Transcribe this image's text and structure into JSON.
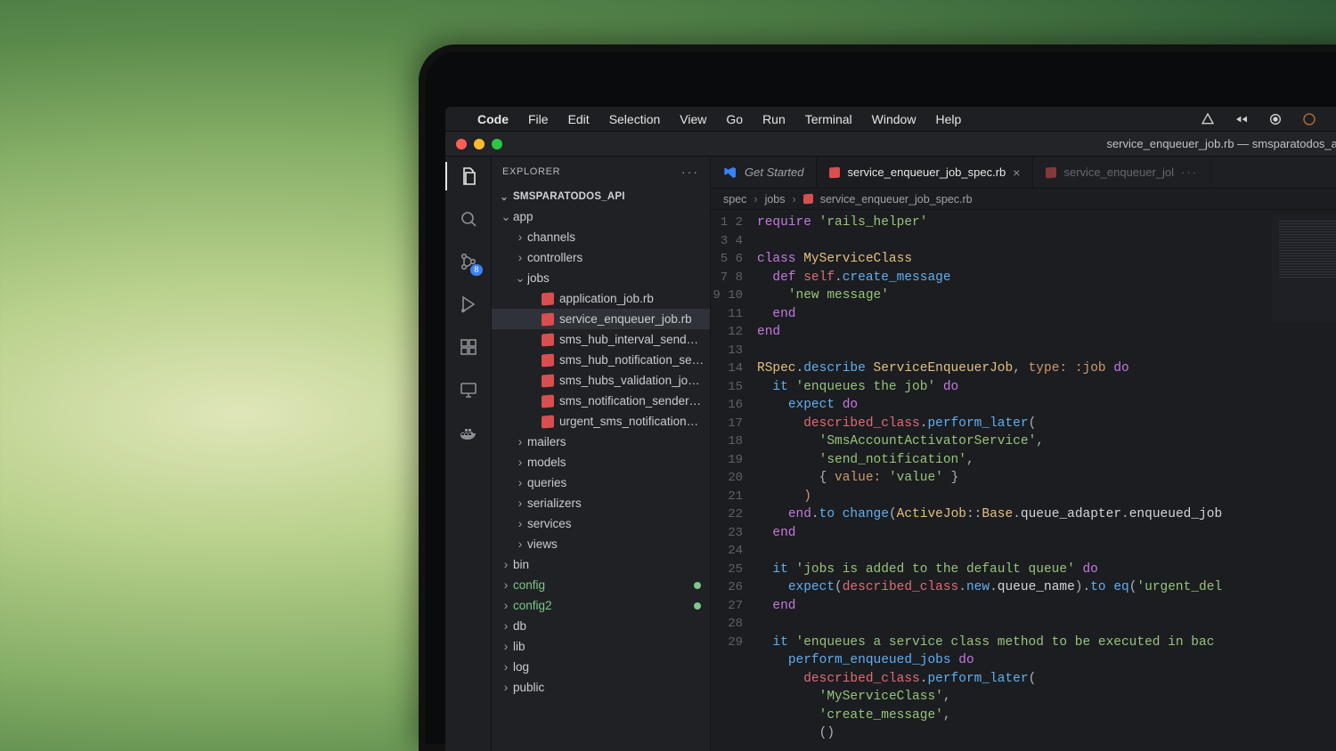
{
  "menubar": {
    "items": [
      "Code",
      "File",
      "Edit",
      "Selection",
      "View",
      "Go",
      "Run",
      "Terminal",
      "Window",
      "Help"
    ]
  },
  "window": {
    "title": "service_enqueuer_job.rb — smsparatodos_api"
  },
  "side": {
    "header": "EXPLORER",
    "section": "SMSPARATODOS_API"
  },
  "activity": {
    "scm_badge": "8"
  },
  "tree": [
    {
      "type": "folder",
      "lbl": "app",
      "depth": 0,
      "open": true
    },
    {
      "type": "folder",
      "lbl": "channels",
      "depth": 1,
      "open": false
    },
    {
      "type": "folder",
      "lbl": "controllers",
      "depth": 1,
      "open": false
    },
    {
      "type": "folder",
      "lbl": "jobs",
      "depth": 1,
      "open": true
    },
    {
      "type": "file",
      "lbl": "application_job.rb",
      "depth": 2,
      "ruby": true
    },
    {
      "type": "file",
      "lbl": "service_enqueuer_job.rb",
      "depth": 2,
      "ruby": true,
      "selected": true
    },
    {
      "type": "file",
      "lbl": "sms_hub_interval_sender_n…",
      "depth": 2,
      "ruby": true
    },
    {
      "type": "file",
      "lbl": "sms_hub_notification_send…",
      "depth": 2,
      "ruby": true
    },
    {
      "type": "file",
      "lbl": "sms_hubs_validation_job.rb",
      "depth": 2,
      "ruby": true
    },
    {
      "type": "file",
      "lbl": "sms_notification_sender_jo…",
      "depth": 2,
      "ruby": true
    },
    {
      "type": "file",
      "lbl": "urgent_sms_notification_se…",
      "depth": 2,
      "ruby": true
    },
    {
      "type": "folder",
      "lbl": "mailers",
      "depth": 1,
      "open": false
    },
    {
      "type": "folder",
      "lbl": "models",
      "depth": 1,
      "open": false
    },
    {
      "type": "folder",
      "lbl": "queries",
      "depth": 1,
      "open": false
    },
    {
      "type": "folder",
      "lbl": "serializers",
      "depth": 1,
      "open": false
    },
    {
      "type": "folder",
      "lbl": "services",
      "depth": 1,
      "open": false
    },
    {
      "type": "folder",
      "lbl": "views",
      "depth": 1,
      "open": false
    },
    {
      "type": "folder",
      "lbl": "bin",
      "depth": 0,
      "open": false
    },
    {
      "type": "folder",
      "lbl": "config",
      "depth": 0,
      "open": false,
      "git": true
    },
    {
      "type": "folder",
      "lbl": "config2",
      "depth": 0,
      "open": false,
      "git": true
    },
    {
      "type": "folder",
      "lbl": "db",
      "depth": 0,
      "open": false
    },
    {
      "type": "folder",
      "lbl": "lib",
      "depth": 0,
      "open": false
    },
    {
      "type": "folder",
      "lbl": "log",
      "depth": 0,
      "open": false
    },
    {
      "type": "folder",
      "lbl": "public",
      "depth": 0,
      "open": false
    }
  ],
  "tabs": [
    {
      "lbl": "Get Started",
      "kind": "welcome",
      "italic": true
    },
    {
      "lbl": "service_enqueuer_job_spec.rb",
      "kind": "ruby",
      "active": true,
      "close": true
    },
    {
      "lbl": "service_enqueuer_jol",
      "kind": "ruby",
      "dim": true,
      "dots": true
    }
  ],
  "breadcrumbs": [
    "spec",
    "jobs",
    "service_enqueuer_job_spec.rb"
  ],
  "code": {
    "lines": [
      {
        "n": 1,
        "h": "<span class='kw'>require</span> <span class='str'>'rails_helper'</span>"
      },
      {
        "n": 2,
        "h": ""
      },
      {
        "n": 3,
        "h": "<span class='kw'>class</span> <span class='cls'>MyServiceClass</span>"
      },
      {
        "n": 4,
        "h": "  <span class='kw'>def</span> <span class='id'>self</span><span class='pun'>.</span><span class='fn'>create_message</span>"
      },
      {
        "n": 5,
        "h": "    <span class='str'>'new message'</span>"
      },
      {
        "n": 6,
        "h": "  <span class='kw'>end</span>"
      },
      {
        "n": 7,
        "h": "<span class='kw'>end</span>"
      },
      {
        "n": 8,
        "h": ""
      },
      {
        "n": 9,
        "h": "<span class='cls'>RSpec</span><span class='pun'>.</span><span class='fn'>describe</span> <span class='cls'>ServiceEnqueuerJob</span><span class='pun'>,</span> <span class='sym'>type:</span> <span class='sym'>:job</span> <span class='kw'>do</span>"
      },
      {
        "n": 10,
        "h": "  <span class='fn'>it</span> <span class='str'>'enqueues the job'</span> <span class='kw'>do</span>"
      },
      {
        "n": 11,
        "h": "    <span class='fn'>expect</span> <span class='kw'>do</span>"
      },
      {
        "n": 12,
        "h": "      <span class='id'>described_class</span><span class='pun'>.</span><span class='fn'>perform_later</span><span class='pun'>(</span>"
      },
      {
        "n": 13,
        "h": "        <span class='str'>'SmsAccountActivatorService'</span><span class='pun'>,</span>"
      },
      {
        "n": 14,
        "h": "        <span class='str'>'send_notification'</span><span class='pun'>,</span>"
      },
      {
        "n": 15,
        "h": "        <span class='pun'>{</span> <span class='sym'>value:</span> <span class='str'>'value'</span> <span class='pun'>}</span>"
      },
      {
        "n": 16,
        "h": "      <span class='sym'>)</span>"
      },
      {
        "n": 17,
        "h": "    <span class='kw'>end</span><span class='pun'>.</span><span class='fn'>to</span> <span class='fn'>change</span><span class='pun'>(</span><span class='cls'>ActiveJob</span><span class='pun'>::</span><span class='cls'>Base</span><span class='pun'>.</span>queue_adapter<span class='pun'>.</span>enqueued_job"
      },
      {
        "n": 18,
        "h": "  <span class='kw'>end</span>"
      },
      {
        "n": 19,
        "h": ""
      },
      {
        "n": 20,
        "h": "  <span class='fn'>it</span> <span class='str'>'jobs is added to the default queue'</span> <span class='kw'>do</span>"
      },
      {
        "n": 21,
        "h": "    <span class='fn'>expect</span><span class='pun'>(</span><span class='id'>described_class</span><span class='pun'>.</span><span class='fn'>new</span><span class='pun'>.</span>queue_name<span class='pun'>)</span><span class='pun'>.</span><span class='fn'>to</span> <span class='fn'>eq</span><span class='pun'>(</span><span class='str'>'urgent_del</span>"
      },
      {
        "n": 22,
        "h": "  <span class='kw'>end</span>"
      },
      {
        "n": 23,
        "h": ""
      },
      {
        "n": 24,
        "h": "  <span class='fn'>it</span> <span class='str'>'enqueues a service class method to be executed in bac</span>"
      },
      {
        "n": 25,
        "h": "    <span class='fn'>perform_enqueued_jobs</span> <span class='kw'>do</span>"
      },
      {
        "n": 26,
        "h": "      <span class='id'>described_class</span><span class='pun'>.</span><span class='fn'>perform_later</span><span class='pun'>(</span>"
      },
      {
        "n": 27,
        "h": "        <span class='str'>'MyServiceClass'</span><span class='pun'>,</span>"
      },
      {
        "n": 28,
        "h": "        <span class='str'>'create_message'</span><span class='pun'>,</span>"
      },
      {
        "n": 29,
        "h": "        <span class='pun'>()</span>"
      }
    ]
  }
}
